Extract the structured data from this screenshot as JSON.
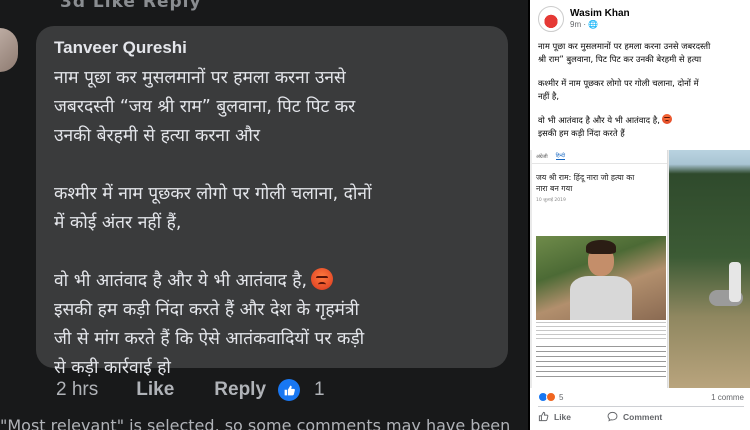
{
  "left_comment": {
    "top_cut_text": "3d  Like  Reply",
    "author": "Tanveer Qureshi",
    "lines": [
      "नाम पूछा कर मुसलमानों पर हमला करना उनसे",
      "जबरदस्ती “जय श्री राम” बुलवाना, पिट पिट कर",
      "उनकी बेरहमी से हत्या करना और",
      "कश्मीर में नाम पूछकर लोगो पर गोली चलाना, दोनों",
      "में कोई अंतर नहीं हैं,",
      "वो भी आतंवाद है और ये भी आतंवाद है,",
      "इसकी हम कड़ी निंदा करते हैं और देश के गृहमंत्री",
      "जी से मांग करते हैं कि ऐसे आतंकवादियों पर कड़ी",
      "से कड़ी कार्रवाई हो"
    ],
    "time": "2 hrs",
    "like_label": "Like",
    "reply_label": "Reply",
    "reaction_count": "1",
    "bottom_cut_text": "\"Most relevant\" is selected, so some comments may have been"
  },
  "right_post": {
    "author": "Wasim Khan",
    "time": "9m · ",
    "lines": [
      "नाम पूछा कर मुसलमानों पर हमला करना उनसे जबरदस्ती",
      "श्री राम” बुलवाना, पिट पिट कर उनकी बेरहमी से हत्या",
      "कश्मीर में नाम पूछकर लोगो पर गोली चलाना, दोनों में",
      "नहीं है,",
      "वो भी आतंवाद है और ये भी आतंवाद है,",
      "इसकी हम कड़ी निंदा करते हैं"
    ],
    "news_tabs": [
      "अंग्रेजी",
      "हिन्दी"
    ],
    "news_title_lines": [
      "जय श्री राम: हिंदू नारा जो हत्या का",
      "नारा बन गया"
    ],
    "news_date": "10 जुलाई 2019",
    "reaction_count": "5",
    "comment_count": "1 comme",
    "like_label": "Like",
    "comment_label": "Comment"
  },
  "colors": {
    "dark_bg": "#18191a",
    "bubble": "#3a3b3c",
    "fb_blue": "#1877f2",
    "muted": "#b0b3b8"
  }
}
